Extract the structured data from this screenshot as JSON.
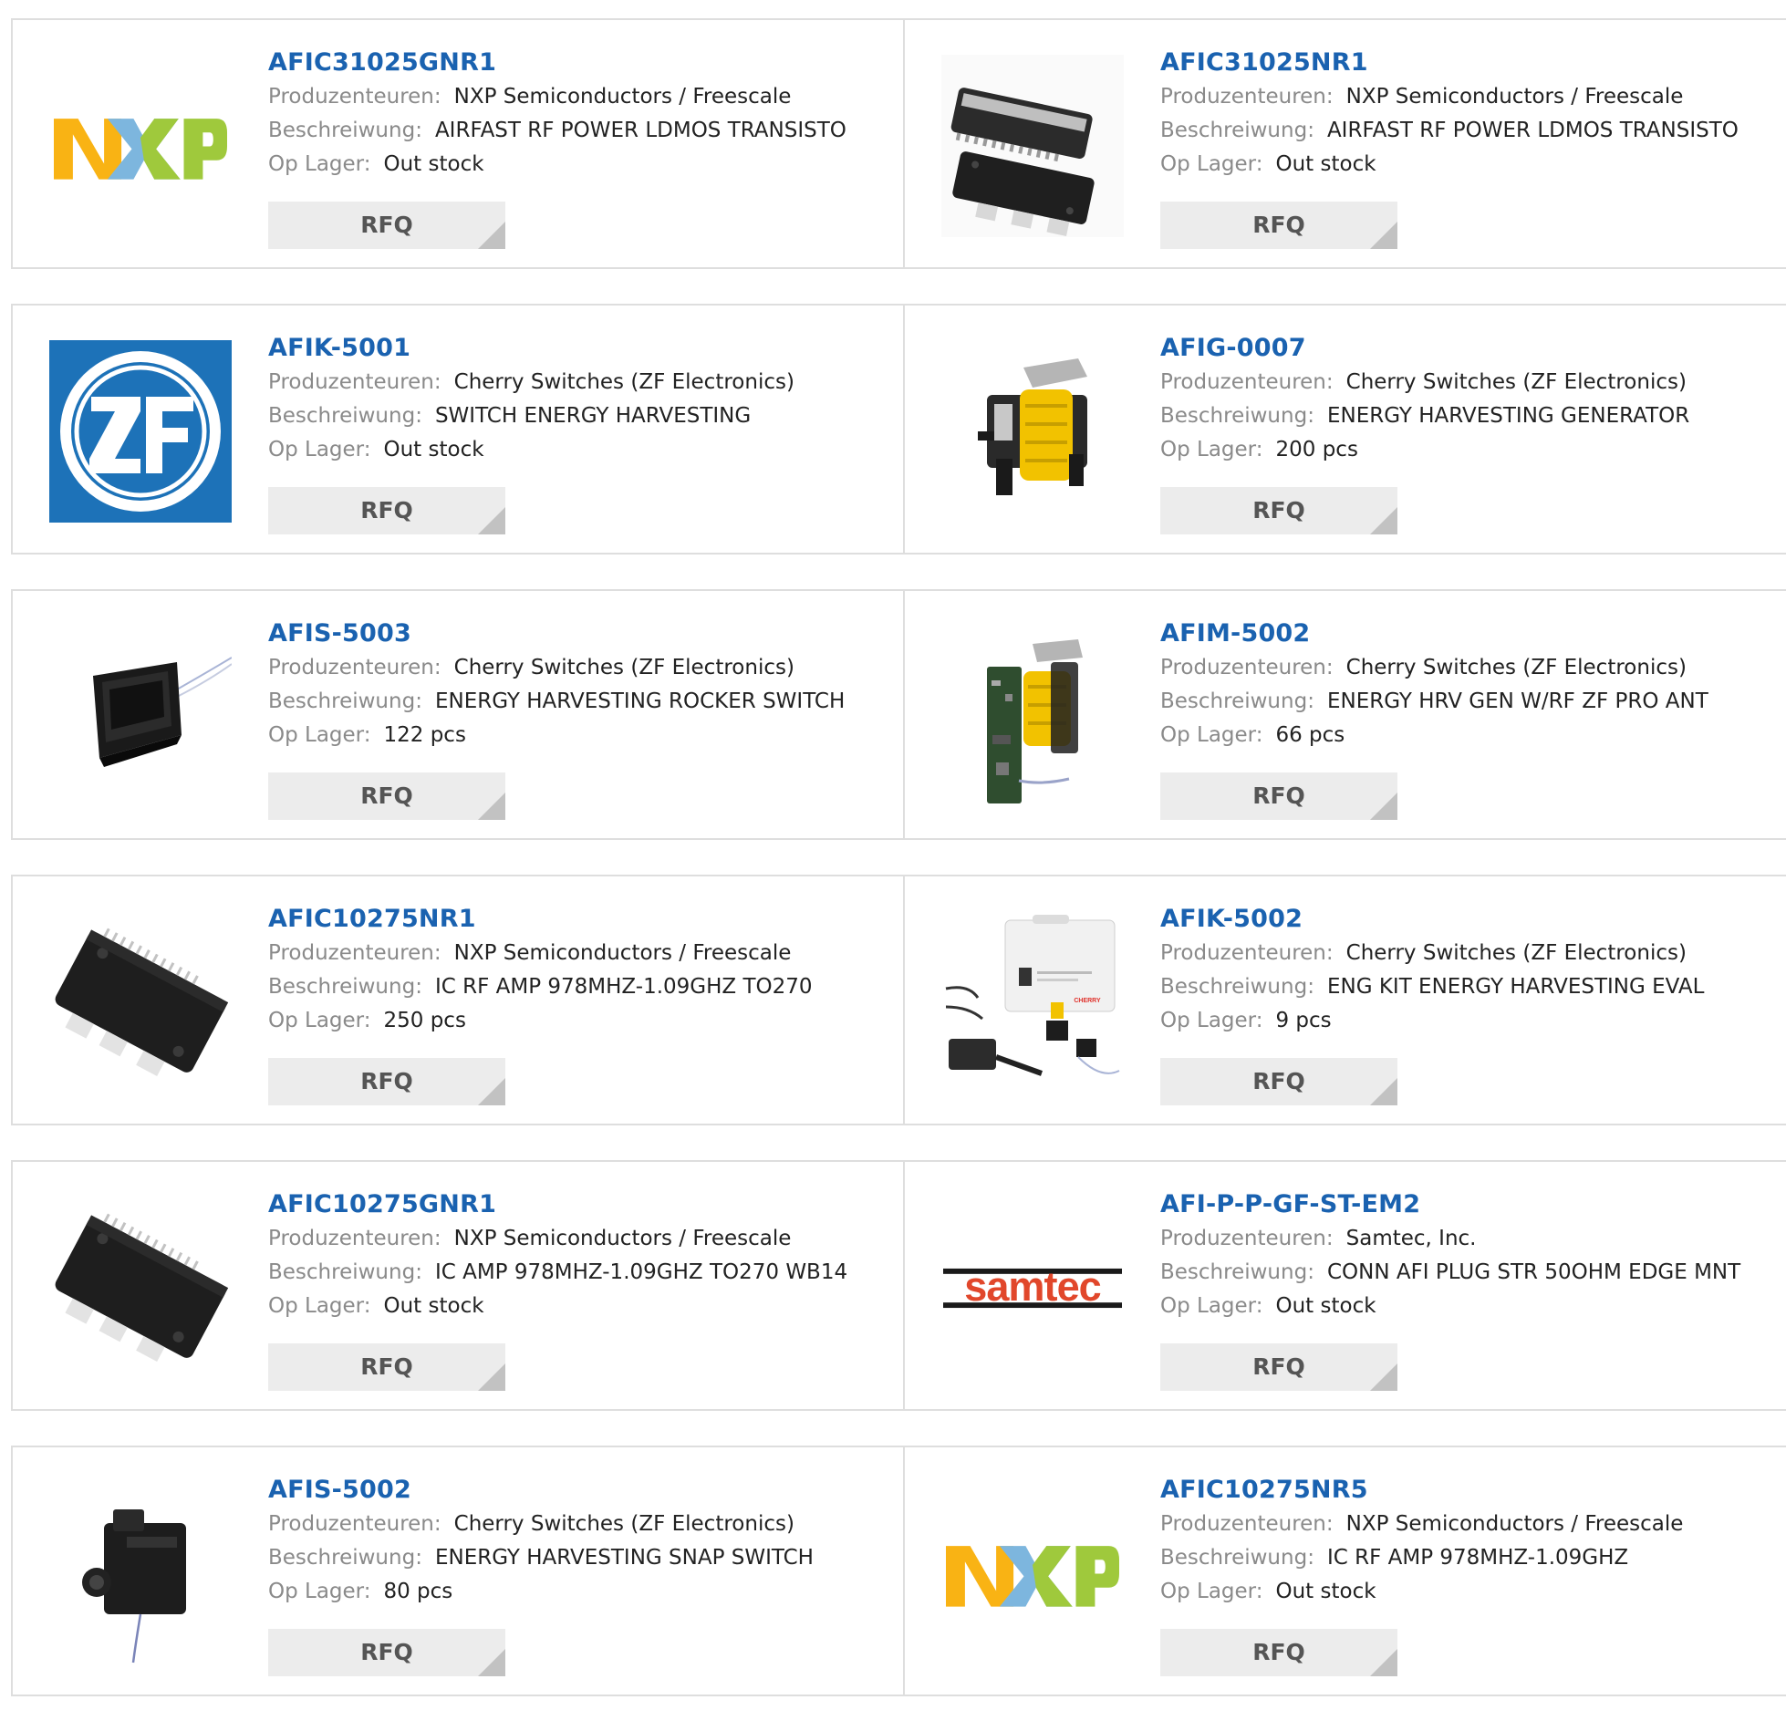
{
  "labels": {
    "manufacturer": "Produzenteuren:",
    "description": "Beschreiwung:",
    "stock": "Op Lager:",
    "rfq": "RFQ"
  },
  "colors": {
    "part_link": "#1a62b0",
    "label": "#8a8a8a",
    "value": "#222222",
    "rfq_bg": "#ececec",
    "rfq_text": "#555555",
    "border": "#dedede"
  },
  "products": [
    {
      "part": "AFIC31025GNR1",
      "manufacturer": "NXP Semiconductors / Freescale",
      "description": "AIRFAST RF POWER LDMOS TRANSISTO",
      "stock": "Out stock",
      "image": "nxp-logo"
    },
    {
      "part": "AFIC31025NR1",
      "manufacturer": "NXP Semiconductors / Freescale",
      "description": "AIRFAST RF POWER LDMOS TRANSISTO",
      "stock": "Out stock",
      "image": "rf-transistor-package-pair"
    },
    {
      "part": "AFIK-5001",
      "manufacturer": "Cherry Switches (ZF Electronics)",
      "description": "SWITCH ENERGY HARVESTING",
      "stock": "Out stock",
      "image": "zf-logo"
    },
    {
      "part": "AFIG-0007",
      "manufacturer": "Cherry Switches (ZF Electronics)",
      "description": "ENERGY HARVESTING GENERATOR",
      "stock": "200 pcs",
      "image": "energy-harvesting-generator"
    },
    {
      "part": "AFIS-5003",
      "manufacturer": "Cherry Switches (ZF Electronics)",
      "description": "ENERGY HARVESTING ROCKER SWITCH",
      "stock": "122 pcs",
      "image": "rocker-switch"
    },
    {
      "part": "AFIM-5002",
      "manufacturer": "Cherry Switches (ZF Electronics)",
      "description": "ENERGY HRV GEN W/RF ZF PRO ANT",
      "stock": "66 pcs",
      "image": "generator-module-pcb"
    },
    {
      "part": "AFIC10275NR1",
      "manufacturer": "NXP Semiconductors / Freescale",
      "description": "IC RF AMP 978MHZ-1.09GHZ TO270",
      "stock": "250 pcs",
      "image": "to270-package"
    },
    {
      "part": "AFIK-5002",
      "manufacturer": "Cherry Switches (ZF Electronics)",
      "description": "ENG KIT ENERGY HARVESTING EVAL",
      "stock": "9 pcs",
      "image": "eval-kit-case"
    },
    {
      "part": "AFIC10275GNR1",
      "manufacturer": "NXP Semiconductors / Freescale",
      "description": "IC AMP 978MHZ-1.09GHZ TO270 WB14",
      "stock": "Out stock",
      "image": "to270-package"
    },
    {
      "part": "AFI-P-P-GF-ST-EM2",
      "manufacturer": "Samtec, Inc.",
      "description": "CONN AFI PLUG STR 50OHM EDGE MNT",
      "stock": "Out stock",
      "image": "samtec-logo"
    },
    {
      "part": "AFIS-5002",
      "manufacturer": "Cherry Switches (ZF Electronics)",
      "description": "ENERGY HARVESTING SNAP SWITCH",
      "stock": "80 pcs",
      "image": "snap-switch"
    },
    {
      "part": "AFIC10275NR5",
      "manufacturer": "NXP Semiconductors / Freescale",
      "description": "IC RF AMP 978MHZ-1.09GHZ",
      "stock": "Out stock",
      "image": "nxp-logo"
    }
  ],
  "logos": {
    "nxp": "NXP",
    "zf": "ZF",
    "samtec": "samtec",
    "cherry": "CHERRY"
  }
}
